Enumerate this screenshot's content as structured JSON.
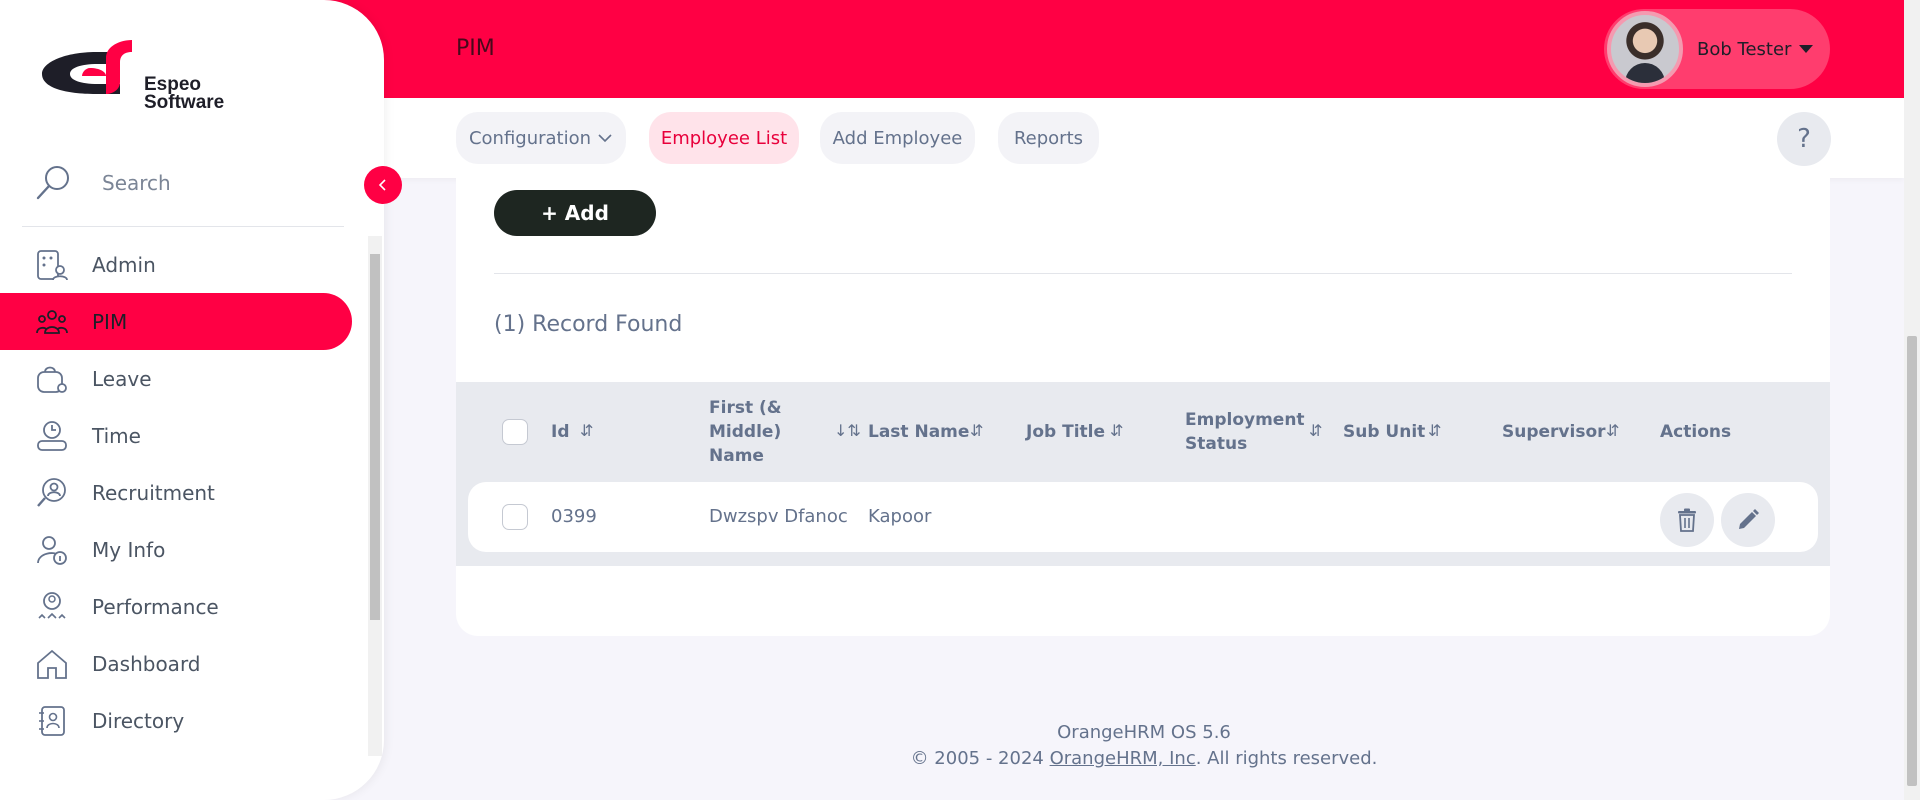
{
  "header": {
    "page_title": "PIM",
    "user_name": "Bob Tester"
  },
  "brand": {
    "line1": "Espeo",
    "line2": "Software",
    "accent": "#ff0044"
  },
  "subnav": {
    "tabs": [
      {
        "label": "Configuration",
        "active": false
      },
      {
        "label": "Employee List",
        "active": true
      },
      {
        "label": "Add Employee",
        "active": false
      },
      {
        "label": "Reports",
        "active": false
      }
    ],
    "help_label": "?"
  },
  "sidebar": {
    "search_label": "Search",
    "items": [
      {
        "label": "Admin",
        "icon": "admin-icon"
      },
      {
        "label": "PIM",
        "icon": "pim-icon",
        "active": true
      },
      {
        "label": "Leave",
        "icon": "leave-icon"
      },
      {
        "label": "Time",
        "icon": "time-icon"
      },
      {
        "label": "Recruitment",
        "icon": "recruitment-icon"
      },
      {
        "label": "My Info",
        "icon": "my-info-icon"
      },
      {
        "label": "Performance",
        "icon": "performance-icon"
      },
      {
        "label": "Dashboard",
        "icon": "dashboard-icon"
      },
      {
        "label": "Directory",
        "icon": "directory-icon"
      }
    ]
  },
  "main": {
    "add_button": "+ Add",
    "records_found": "(1) Record Found",
    "columns": [
      {
        "label": "Id"
      },
      {
        "label": "First (& Middle) Name"
      },
      {
        "label": "Last Name"
      },
      {
        "label": "Job Title"
      },
      {
        "label": "Employment Status"
      },
      {
        "label": "Sub Unit"
      },
      {
        "label": "Supervisor"
      },
      {
        "label": "Actions"
      }
    ],
    "rows": [
      {
        "id": "0399",
        "first_middle": "Dwzspv Dfanoc",
        "last_name": "Kapoor",
        "job_title": "",
        "employment_status": "",
        "sub_unit": "",
        "supervisor": ""
      }
    ]
  },
  "footer": {
    "version": "OrangeHRM OS 5.6",
    "copyright_prefix": "© 2005 - 2024 ",
    "company_link": "OrangeHRM, Inc",
    "copyright_suffix": ". All rights reserved."
  }
}
